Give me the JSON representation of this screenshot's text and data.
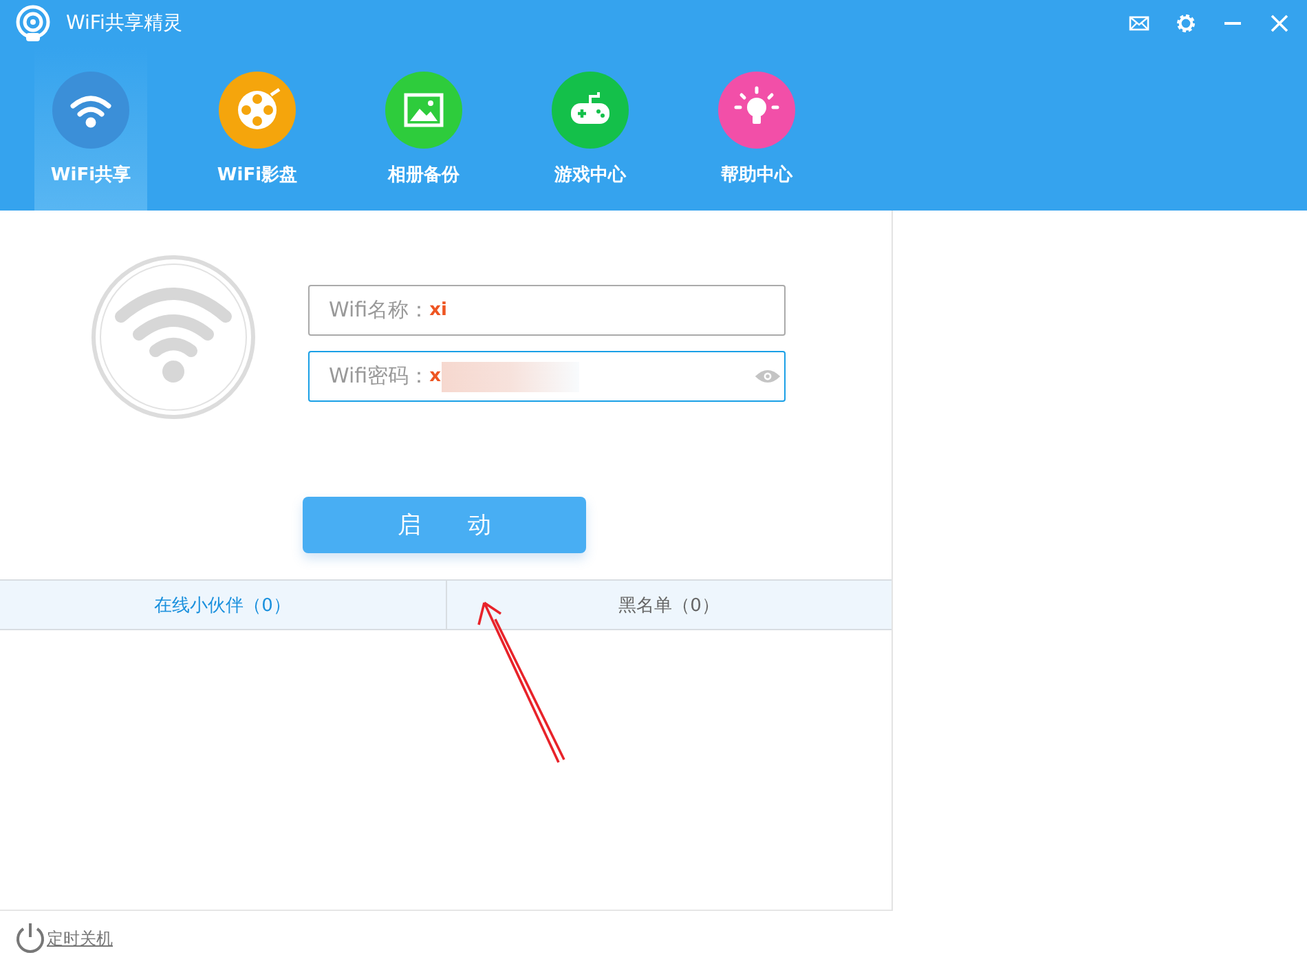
{
  "window": {
    "title": "WiFi共享精灵"
  },
  "nav": [
    {
      "label": "WiFi共享",
      "kind": "wifi",
      "color": "#3b8fd8",
      "selected": true
    },
    {
      "label": "WiFi影盘",
      "kind": "film",
      "color": "#f5a50c",
      "selected": false
    },
    {
      "label": "相册备份",
      "kind": "photo",
      "color": "#2ecc3c",
      "selected": false
    },
    {
      "label": "游戏中心",
      "kind": "game",
      "color": "#14c04a",
      "selected": false
    },
    {
      "label": "帮助中心",
      "kind": "bulb",
      "color": "#f24fa8",
      "selected": false
    }
  ],
  "form": {
    "name_label": "Wifi名称：",
    "name_value": "xi",
    "password_label": "Wifi密码：",
    "password_value": "x"
  },
  "start_button": "启　　动",
  "lists": [
    {
      "label": "在线小伙伴（0）",
      "selected": true
    },
    {
      "label": "黑名单（0）",
      "selected": false
    }
  ],
  "footer": {
    "shutdown_link": "定时关机"
  }
}
